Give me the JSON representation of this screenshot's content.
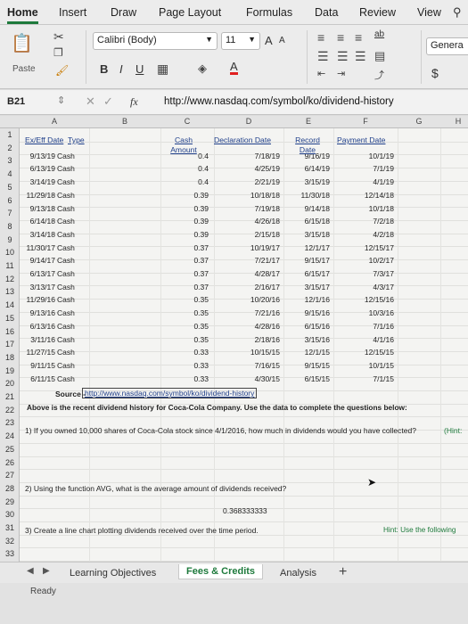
{
  "ribbon_tabs": [
    "Home",
    "Insert",
    "Draw",
    "Page Layout",
    "Formulas",
    "Data",
    "Review",
    "View"
  ],
  "ribbon": {
    "paste_label": "Paste",
    "font_name": "Calibri (Body)",
    "font_size": "11",
    "grow_font": "A",
    "shrink_font": "A",
    "bold": "B",
    "italic": "I",
    "underline": "U",
    "number_format": "Genera",
    "currency": "$",
    "wrap_text": "ab"
  },
  "formula_bar": {
    "cell_ref": "B21",
    "fx": "fx",
    "content": "http://www.nasdaq.com/symbol/ko/dividend-history"
  },
  "columns": [
    "A",
    "B",
    "C",
    "D",
    "E",
    "F",
    "G",
    "H"
  ],
  "rows": [
    "1",
    "2",
    "3",
    "4",
    "5",
    "6",
    "7",
    "8",
    "9",
    "10",
    "11",
    "12",
    "13",
    "14",
    "15",
    "16",
    "17",
    "18",
    "19",
    "20",
    "21",
    "22",
    "23",
    "24",
    "25",
    "26",
    "27",
    "28",
    "29",
    "30",
    "31",
    "32",
    "33"
  ],
  "headers": {
    "ex_date": "Ex/Eff Date",
    "type": "Type",
    "cash_amount": "Cash Amount",
    "declaration_date": "Declaration Date",
    "record_date": "Record Date",
    "payment_date": "Payment Date"
  },
  "dividends": [
    {
      "ex": "9/13/19",
      "type": "Cash",
      "amt": "0.4",
      "decl": "7/18/19",
      "rec": "9/16/19",
      "pay": "10/1/19"
    },
    {
      "ex": "6/13/19",
      "type": "Cash",
      "amt": "0.4",
      "decl": "4/25/19",
      "rec": "6/14/19",
      "pay": "7/1/19"
    },
    {
      "ex": "3/14/19",
      "type": "Cash",
      "amt": "0.4",
      "decl": "2/21/19",
      "rec": "3/15/19",
      "pay": "4/1/19"
    },
    {
      "ex": "11/29/18",
      "type": "Cash",
      "amt": "0.39",
      "decl": "10/18/18",
      "rec": "11/30/18",
      "pay": "12/14/18"
    },
    {
      "ex": "9/13/18",
      "type": "Cash",
      "amt": "0.39",
      "decl": "7/19/18",
      "rec": "9/14/18",
      "pay": "10/1/18"
    },
    {
      "ex": "6/14/18",
      "type": "Cash",
      "amt": "0.39",
      "decl": "4/26/18",
      "rec": "6/15/18",
      "pay": "7/2/18"
    },
    {
      "ex": "3/14/18",
      "type": "Cash",
      "amt": "0.39",
      "decl": "2/15/18",
      "rec": "3/15/18",
      "pay": "4/2/18"
    },
    {
      "ex": "11/30/17",
      "type": "Cash",
      "amt": "0.37",
      "decl": "10/19/17",
      "rec": "12/1/17",
      "pay": "12/15/17"
    },
    {
      "ex": "9/14/17",
      "type": "Cash",
      "amt": "0.37",
      "decl": "7/21/17",
      "rec": "9/15/17",
      "pay": "10/2/17"
    },
    {
      "ex": "6/13/17",
      "type": "Cash",
      "amt": "0.37",
      "decl": "4/28/17",
      "rec": "6/15/17",
      "pay": "7/3/17"
    },
    {
      "ex": "3/13/17",
      "type": "Cash",
      "amt": "0.37",
      "decl": "2/16/17",
      "rec": "3/15/17",
      "pay": "4/3/17"
    },
    {
      "ex": "11/29/16",
      "type": "Cash",
      "amt": "0.35",
      "decl": "10/20/16",
      "rec": "12/1/16",
      "pay": "12/15/16"
    },
    {
      "ex": "9/13/16",
      "type": "Cash",
      "amt": "0.35",
      "decl": "7/21/16",
      "rec": "9/15/16",
      "pay": "10/3/16"
    },
    {
      "ex": "6/13/16",
      "type": "Cash",
      "amt": "0.35",
      "decl": "4/28/16",
      "rec": "6/15/16",
      "pay": "7/1/16"
    },
    {
      "ex": "3/11/16",
      "type": "Cash",
      "amt": "0.35",
      "decl": "2/18/16",
      "rec": "3/15/16",
      "pay": "4/1/16"
    },
    {
      "ex": "11/27/15",
      "type": "Cash",
      "amt": "0.33",
      "decl": "10/15/15",
      "rec": "12/1/15",
      "pay": "12/15/15"
    },
    {
      "ex": "9/11/15",
      "type": "Cash",
      "amt": "0.33",
      "decl": "7/16/15",
      "rec": "9/15/15",
      "pay": "10/1/15"
    },
    {
      "ex": "6/11/15",
      "type": "Cash",
      "amt": "0.33",
      "decl": "4/30/15",
      "rec": "6/15/15",
      "pay": "7/1/15"
    }
  ],
  "notes": {
    "source_label": "Source -",
    "source_link": "http://www.nasdaq.com/symbol/ko/dividend-history",
    "row23": "Above is the recent dividend history for Coca-Cola Company. Use the data to complete the questions below:",
    "row25": "1) If you owned 10,000 shares of Coca-Cola stock since 4/1/2016, how much in dividends would you have collected?",
    "row25_hint": "(Hint:",
    "row29": "2) Using the function AVG, what is the average amount of dividends received?",
    "row31_value": "0.368333333",
    "row33": "3) Create a line chart plotting dividends received over the time period.",
    "row33_hint": "Hint: Use the following"
  },
  "sheet_tabs": [
    "Learning Objectives",
    "Fees & Credits",
    "Analysis"
  ],
  "status": "Ready",
  "colors": {
    "accent": "#1e7a3c",
    "link": "#1f3f8a",
    "hint": "#1e7a3c"
  }
}
